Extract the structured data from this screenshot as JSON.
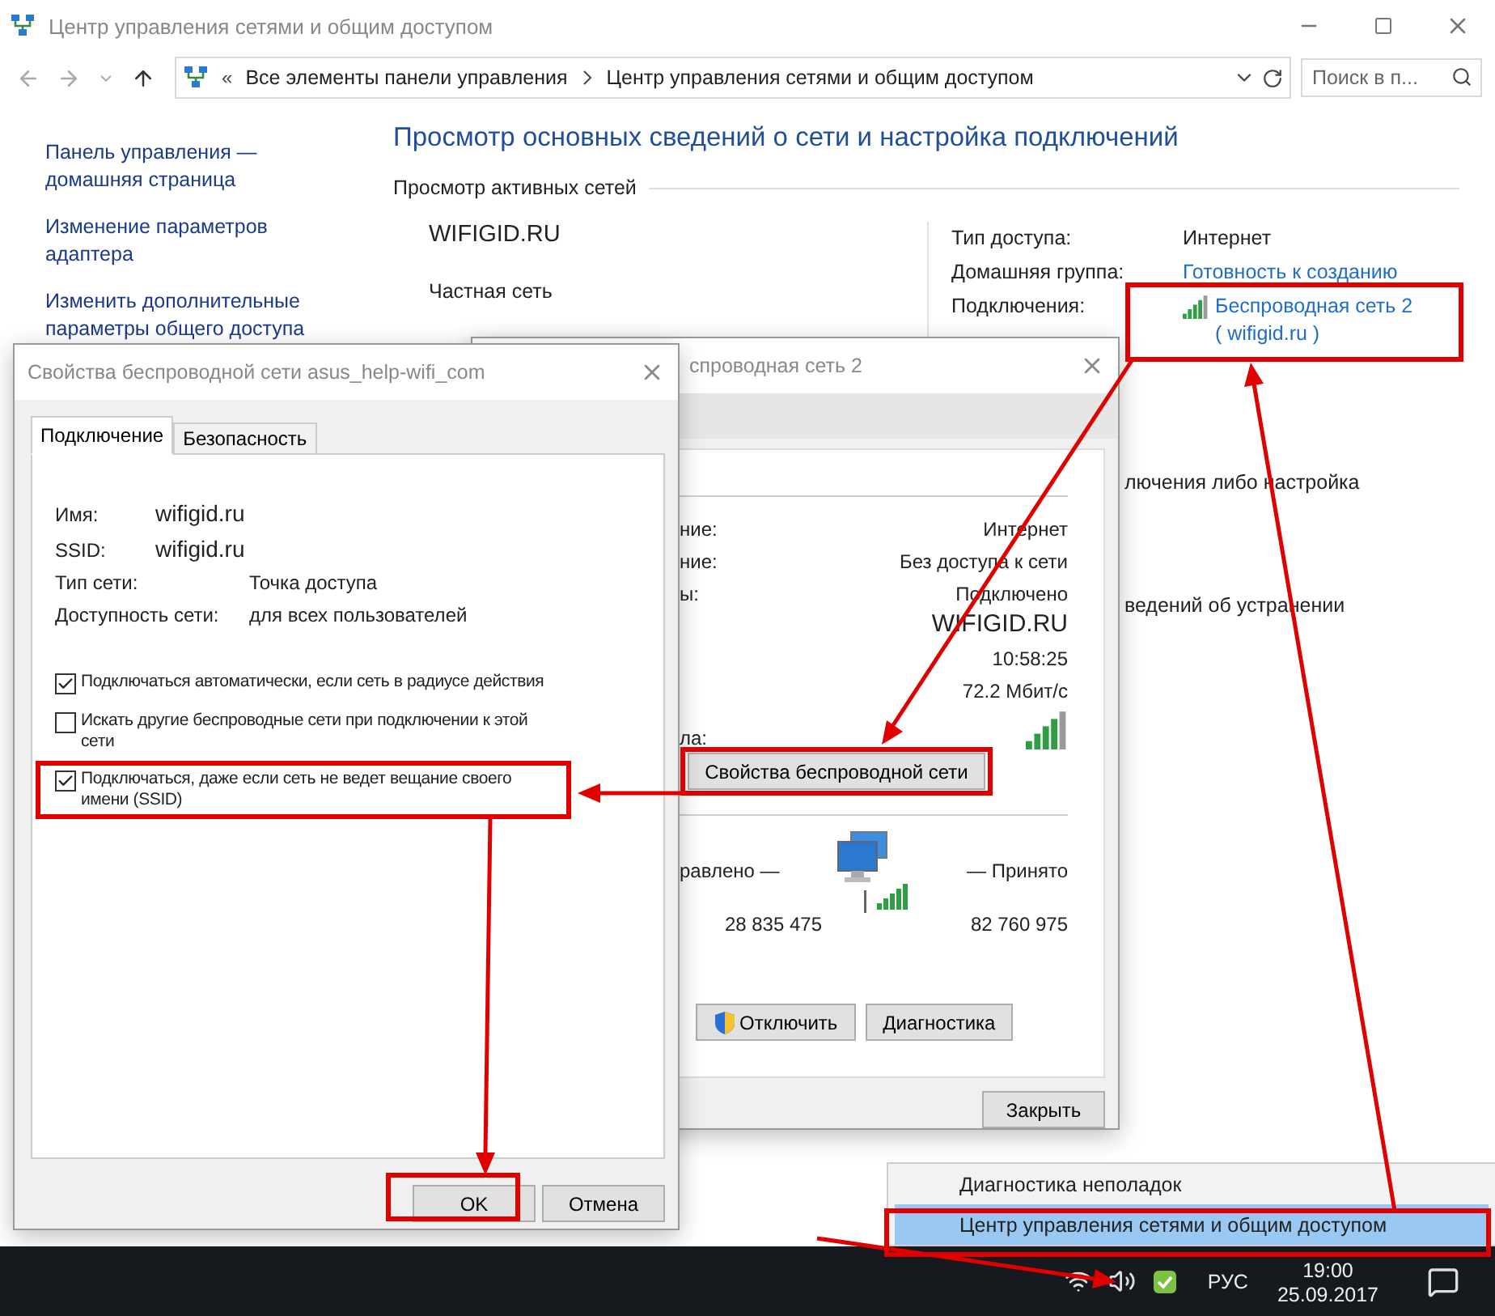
{
  "window": {
    "title": "Центр управления сетями и общим доступом"
  },
  "address_bar": {
    "overflow": "«",
    "breadcrumbs": [
      "Все элементы панели управления",
      "Центр управления сетями и общим доступом"
    ]
  },
  "search": {
    "placeholder": "Поиск в п..."
  },
  "sidebar": {
    "links": [
      "Панель управления — домашняя страница",
      "Изменение параметров адаптера",
      "Изменить дополнительные параметры общего доступа"
    ]
  },
  "main": {
    "heading": "Просмотр основных сведений о сети и настройка подключений",
    "section": "Просмотр активных сетей",
    "network_name": "WIFIGID.RU",
    "network_type": "Частная сеть",
    "details": [
      {
        "label": "Тип доступа:",
        "kind": "text",
        "lines": [
          "Интернет"
        ]
      },
      {
        "label": "Домашняя группа:",
        "kind": "link",
        "lines": [
          "Готовность к созданию"
        ]
      },
      {
        "label": "Подключения:",
        "kind": "connection",
        "lines": [
          "Беспроводная сеть 2",
          "( wifigid.ru )"
        ]
      }
    ],
    "partial_texts": [
      "лючения либо настройка",
      "ведений об устранении"
    ]
  },
  "status_dialog": {
    "title": "спроводная сеть 2",
    "rows": [
      {
        "label": "ние:",
        "value": "Интернет",
        "kind": "text"
      },
      {
        "label": "ние:",
        "value": "Без доступа к сети",
        "kind": "text"
      },
      {
        "label": "ы:",
        "value": "Подключено",
        "kind": "text"
      },
      {
        "value": "WIFIGID.RU",
        "kind": "large"
      },
      {
        "value": "10:58:25",
        "kind": "text"
      },
      {
        "value": "72.2 Мбит/с",
        "kind": "text"
      },
      {
        "label": "ла:",
        "kind": "signal"
      }
    ],
    "properties_button": "Свойства беспроводной сети",
    "activity": {
      "sent_label": "равлено —",
      "received_label": "— Принято",
      "sent": "28 835 475",
      "received": "82 760 975"
    },
    "buttons": [
      {
        "label": "Отключить",
        "kind": "shield"
      },
      {
        "label": "Диагностика",
        "kind": "plain"
      }
    ],
    "close_button": "Закрыть"
  },
  "properties_dialog": {
    "title": "Свойства беспроводной сети asus_help-wifi_com",
    "tabs": [
      {
        "label": "Подключение",
        "selected": true
      },
      {
        "label": "Безопасность",
        "selected": false
      }
    ],
    "fields": [
      {
        "label": "Имя:",
        "value": "wifigid.ru",
        "kind": "large"
      },
      {
        "label": "SSID:",
        "value": "wifigid.ru",
        "kind": "large"
      },
      {
        "label": "Тип сети:",
        "value": "Точка доступа",
        "kind": "text"
      },
      {
        "label": "Доступность сети:",
        "value": "для всех пользователей",
        "kind": "text"
      }
    ],
    "checkboxes": [
      {
        "label": "Подключаться автоматически, если сеть в радиусе действия",
        "checked": true,
        "highlighted": false
      },
      {
        "label": "Искать другие беспроводные сети при подключении к этой сети",
        "checked": false,
        "highlighted": false
      },
      {
        "label": "Подключаться, даже если сеть не ведет вещание своего имени (SSID)",
        "checked": true,
        "highlighted": true
      }
    ],
    "buttons": [
      "OK",
      "Отмена"
    ]
  },
  "context_menu": {
    "items": [
      {
        "label": "Диагностика неполадок",
        "selected": false
      },
      {
        "label": "Центр управления сетями и общим доступом",
        "selected": true
      }
    ]
  },
  "taskbar": {
    "language": "РУС",
    "time": "19:00",
    "date": "25.09.2017"
  }
}
